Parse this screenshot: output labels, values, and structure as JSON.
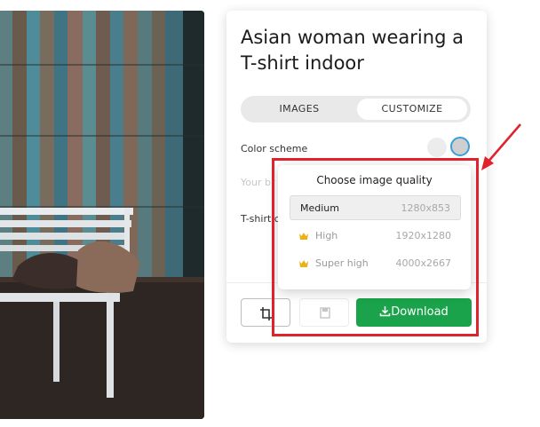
{
  "panel": {
    "title": "Asian woman wearing a T-shirt indoor",
    "tabs": [
      {
        "label": "IMAGES"
      },
      {
        "label": "CUSTOMIZE"
      }
    ],
    "color_scheme_label": "Color scheme",
    "your_brand_placeholder": "Your br",
    "tshirt_label": "T-shirt c",
    "download_label": "Download"
  },
  "quality_dropdown": {
    "title": "Choose image quality",
    "options": [
      {
        "name": "Medium",
        "resolution": "1280x853",
        "selected": true,
        "premium": false
      },
      {
        "name": "High",
        "resolution": "1920x1280",
        "selected": false,
        "premium": true
      },
      {
        "name": "Super high",
        "resolution": "4000x2667",
        "selected": false,
        "premium": true
      }
    ]
  },
  "colors": {
    "download_green": "#1aa34a",
    "highlight_red": "#e0222a",
    "crown_gold": "#e8b21a",
    "selected_swatch_blue": "#3aa0d8"
  },
  "icons": {
    "crop": "crop-icon",
    "save": "save-icon",
    "download": "download-icon",
    "crown": "crown-icon"
  }
}
